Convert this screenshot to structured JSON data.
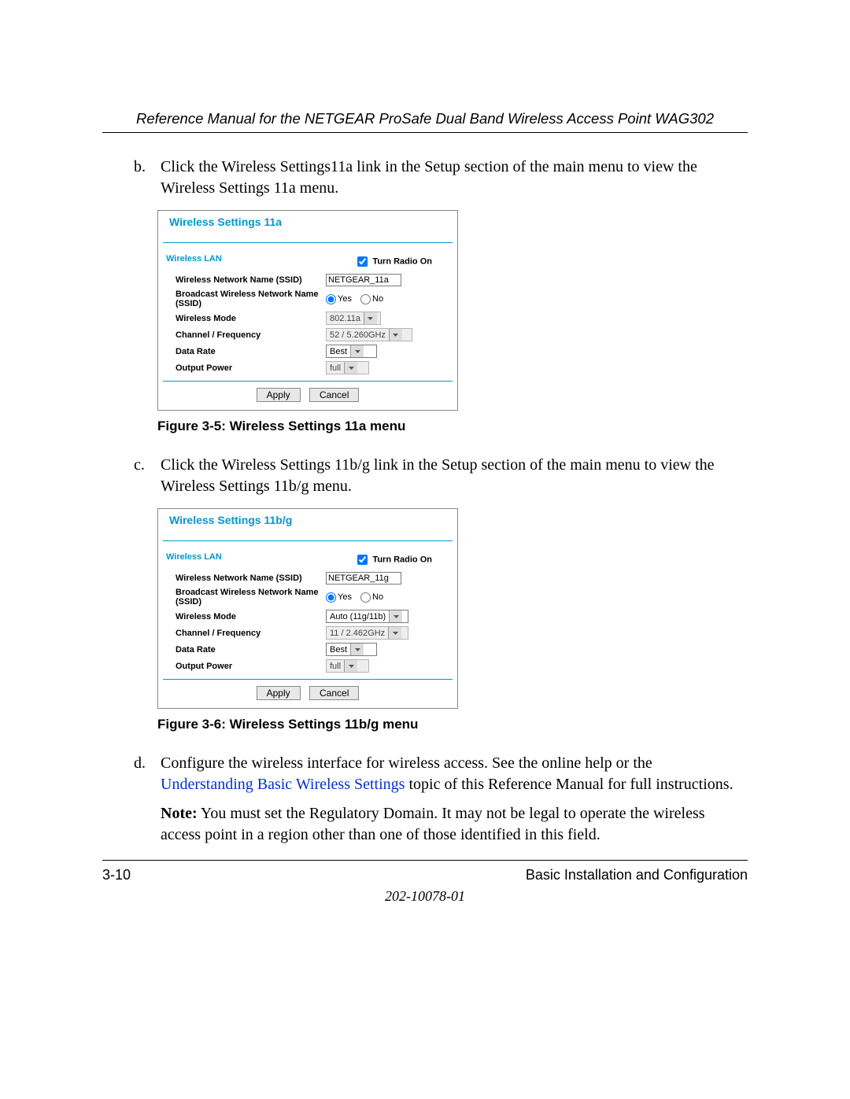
{
  "header": {
    "title": "Reference Manual for the NETGEAR ProSafe Dual Band Wireless Access Point WAG302"
  },
  "items": {
    "b": {
      "marker": "b.",
      "text": "Click the Wireless Settings11a link in the Setup section of the main menu to view the Wireless Settings 11a menu."
    },
    "c": {
      "marker": "c.",
      "text": "Click the Wireless Settings 11b/g link in the Setup section of the main menu to view the Wireless Settings 11b/g menu."
    },
    "d": {
      "marker": "d.",
      "text_before_link": "Configure the wireless interface for wireless access. See the online help or the ",
      "link_text": "Understanding Basic Wireless Settings",
      "text_after_link": " topic of this Reference Manual for full instructions.",
      "note_label": "Note:",
      "note_text": " You must set the Regulatory Domain. It may not be legal to operate the wireless access point in a region other than one of those identified in this field."
    }
  },
  "panel11a": {
    "title": "Wireless Settings 11a",
    "section": "Wireless LAN",
    "turn_radio": "Turn Radio On",
    "fields": {
      "ssid_label": "Wireless Network Name (SSID)",
      "ssid_value": "NETGEAR_11a",
      "broadcast_label": "Broadcast Wireless Network Name (SSID)",
      "yes": "Yes",
      "no": "No",
      "mode_label": "Wireless Mode",
      "mode_value": "802.11a",
      "channel_label": "Channel / Frequency",
      "channel_value": "52 / 5.260GHz",
      "rate_label": "Data Rate",
      "rate_value": "Best",
      "power_label": "Output Power",
      "power_value": "full"
    },
    "apply": "Apply",
    "cancel": "Cancel"
  },
  "panel11bg": {
    "title": "Wireless Settings 11b/g",
    "section": "Wireless LAN",
    "turn_radio": "Turn Radio On",
    "fields": {
      "ssid_label": "Wireless Network Name (SSID)",
      "ssid_value": "NETGEAR_11g",
      "broadcast_label": "Broadcast Wireless Network Name (SSID)",
      "yes": "Yes",
      "no": "No",
      "mode_label": "Wireless Mode",
      "mode_value": "Auto (11g/11b)",
      "channel_label": "Channel / Frequency",
      "channel_value": "11 / 2.462GHz",
      "rate_label": "Data Rate",
      "rate_value": "Best",
      "power_label": "Output Power",
      "power_value": "full"
    },
    "apply": "Apply",
    "cancel": "Cancel"
  },
  "captions": {
    "fig35": "Figure 3-5: Wireless Settings 11a menu",
    "fig36": "Figure 3-6: Wireless Settings 11b/g menu"
  },
  "footer": {
    "page": "3-10",
    "chapter": "Basic Installation and Configuration",
    "docnum": "202-10078-01"
  }
}
